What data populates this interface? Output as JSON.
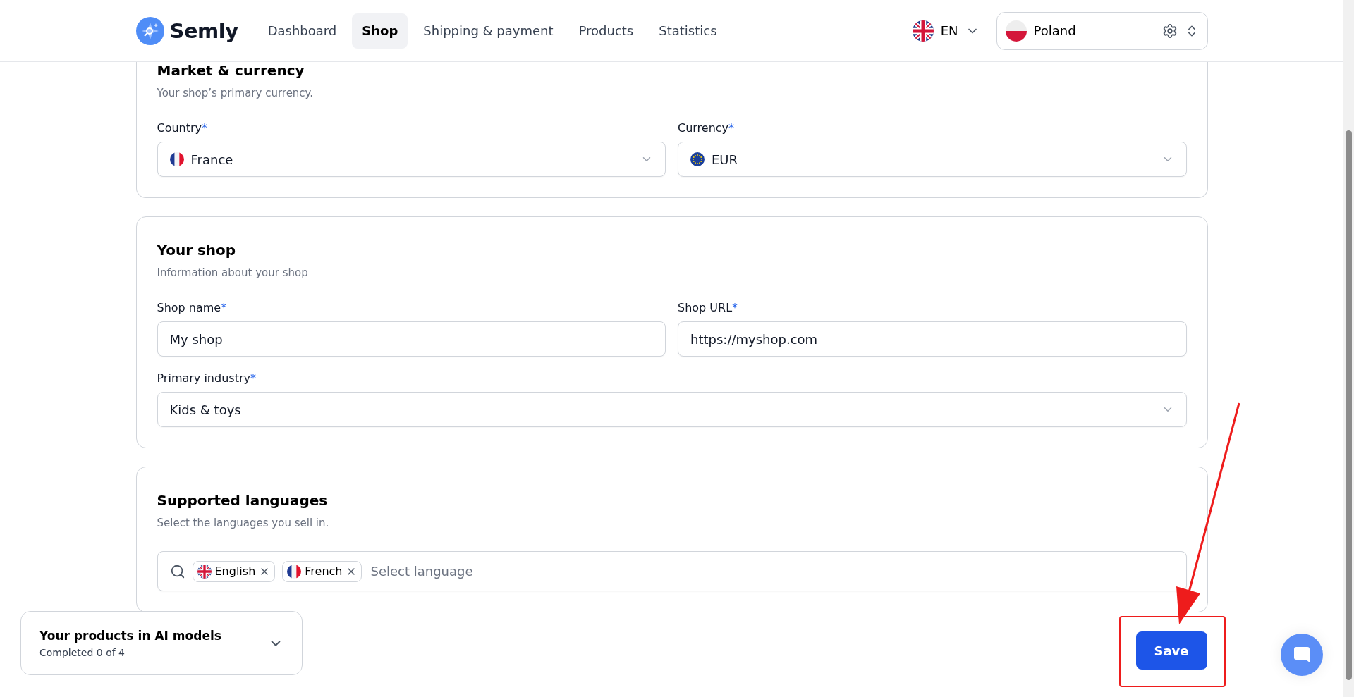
{
  "header": {
    "brand": "Semly",
    "nav": [
      {
        "label": "Dashboard",
        "selected": false
      },
      {
        "label": "Shop",
        "selected": true
      },
      {
        "label": "Shipping & payment",
        "selected": false
      },
      {
        "label": "Products",
        "selected": false
      },
      {
        "label": "Statistics",
        "selected": false
      }
    ],
    "language": {
      "code": "EN",
      "flag": {
        "kind": "gb"
      }
    },
    "market": {
      "name": "Poland",
      "flag": {
        "kind": "pl"
      }
    }
  },
  "sections": [
    {
      "title": "Market & currency",
      "subtitle": "Your shop’s primary currency.",
      "fields": [
        {
          "label": "Country",
          "mark": "*",
          "kind": "select",
          "value": "France",
          "flag": {
            "kind": "fr"
          },
          "wide": false
        },
        {
          "label": "Currency",
          "mark": "*",
          "kind": "select",
          "value": "EUR",
          "flag": {
            "kind": "eu"
          },
          "wide": false
        }
      ]
    },
    {
      "title": "Your shop",
      "subtitle": "Information about your shop",
      "fields": [
        {
          "label": "Shop name",
          "mark": "*",
          "kind": "text",
          "value": "My shop",
          "wide": false
        },
        {
          "label": "Shop URL",
          "mark": "*",
          "kind": "text",
          "value": "https://myshop.com",
          "wide": false
        },
        {
          "label": "Primary industry",
          "mark": "*",
          "kind": "select",
          "value": "Kids & toys",
          "wide": true
        }
      ]
    },
    {
      "title": "Supported languages",
      "subtitle": "Select the languages you sell in.",
      "fields": [
        {
          "kind": "tags",
          "placeholder": "Select language",
          "wide": true,
          "tags": [
            {
              "label": "English",
              "flag": {
                "kind": "gb"
              }
            },
            {
              "label": "French",
              "flag": {
                "kind": "fr"
              }
            }
          ]
        }
      ]
    }
  ],
  "ai_panel": {
    "title": "Your products in AI models",
    "progress": "Completed 0 of 4"
  },
  "save_button": "Save"
}
